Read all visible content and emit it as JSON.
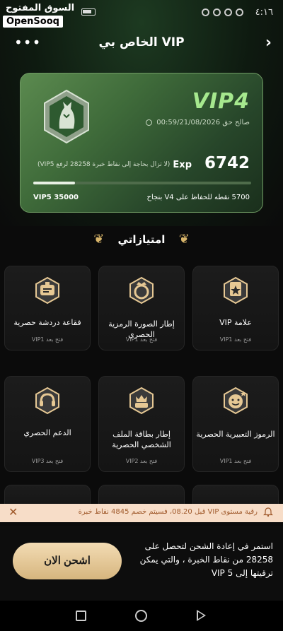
{
  "status": {
    "time": "٤:١٦",
    "watermark_ar": "السوق المفتوح",
    "watermark_en": "OpenSooq"
  },
  "header": {
    "title": "الخاص بي VIP",
    "more_icon": "more-dots-icon",
    "back_icon": "chevron-right-icon"
  },
  "vip_card": {
    "level": "VIP4",
    "validity": "صالح حق 00:59/21/08/2026",
    "exp_label": "Exp",
    "exp_value": "6742",
    "exp_note": "(لا تزال بحاجة إلى نقاط خبرة 28258 لرفع VIP5)",
    "progress_fraction": 0.19,
    "next_level": "VIP5 35000",
    "keep_note": "5700 نقطه للحفاظ على V4 بنجاح"
  },
  "privileges": {
    "heading": "امتيازاتي",
    "tiles": [
      {
        "title": "علامة VIP",
        "sub": "فتح بعد VIP1",
        "icon": "vip-badge-icon"
      },
      {
        "title": "إطار الصورة الرمزية الحصري",
        "sub": "فتح بعد VIP1",
        "icon": "avatar-frame-icon"
      },
      {
        "title": "فقاعة دردشة حصرية",
        "sub": "فتح بعد VIP1",
        "icon": "chat-bubble-icon"
      },
      {
        "title": "الرموز التعبيرية الحصرية",
        "sub": "فتح بعد VIP1",
        "icon": "emoji-icon"
      },
      {
        "title": "إطار بطاقة الملف الشخصي الحصرية",
        "sub": "فتح بعد VIP2",
        "icon": "profile-card-frame-icon"
      },
      {
        "title": "الدعم الحصري",
        "sub": "فتح بعد VIP3",
        "icon": "headset-icon"
      }
    ]
  },
  "banner": {
    "text": "رقية مستوى VIP قبل 08.20، فسيتم خصم 4845 نقاط خبرة",
    "icon": "bell-icon",
    "close": "✕"
  },
  "bottom": {
    "button_label": "اشحن الان",
    "text": "استمر في إعادة الشحن لتحصل على 28258 من نقاط الخبرة ، والتي يمكن ترقيتها إلى VIP 5"
  },
  "colors": {
    "accent_gold": "#d6b57e",
    "vip_green": "#a6e88e",
    "banner_bg": "#f7ddc8"
  }
}
